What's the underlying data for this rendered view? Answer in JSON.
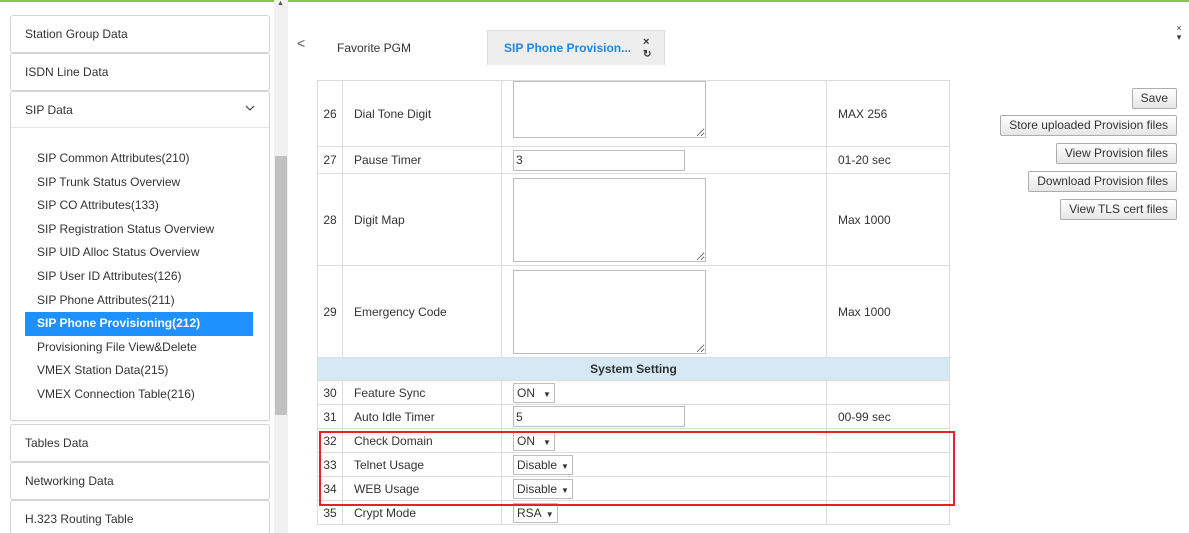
{
  "sidebar": {
    "groups": {
      "station_group": "Station Group Data",
      "isdn_line": "ISDN Line Data",
      "sip_data": "SIP Data",
      "tables": "Tables Data",
      "networking": "Networking Data",
      "h323": "H.323 Routing Table"
    },
    "sip_items": [
      "SIP Common Attributes(210)",
      "SIP Trunk Status Overview",
      "SIP CO Attributes(133)",
      "SIP Registration Status Overview",
      "SIP UID Alloc Status Overview",
      "SIP User ID Attributes(126)",
      "SIP Phone Attributes(211)",
      "SIP Phone Provisioning(212)",
      "Provisioning File View&Delete",
      "VMEX Station Data(215)",
      "VMEX Connection Table(216)"
    ],
    "active_index": 7
  },
  "tabs": {
    "nav_prev": "<",
    "favorite": "Favorite PGM",
    "active": "SIP Phone Provision...",
    "close_glyph": "×",
    "refresh_glyph": "↻"
  },
  "window": {
    "close_glyph": "×",
    "menu_glyph": "▾"
  },
  "rows": {
    "r26": {
      "num": "26",
      "name": "Dial Tone Digit",
      "value": "",
      "note": "MAX 256"
    },
    "r27": {
      "num": "27",
      "name": "Pause Timer",
      "value": "3",
      "note": "01-20 sec"
    },
    "r28": {
      "num": "28",
      "name": "Digit Map",
      "value": "",
      "note": "Max 1000"
    },
    "r29": {
      "num": "29",
      "name": "Emergency Code",
      "value": "",
      "note": "Max 1000"
    },
    "section": "System Setting",
    "r30": {
      "num": "30",
      "name": "Feature Sync",
      "value": "ON",
      "note": ""
    },
    "r31": {
      "num": "31",
      "name": "Auto Idle Timer",
      "value": "5",
      "note": "00-99 sec"
    },
    "r32": {
      "num": "32",
      "name": "Check Domain",
      "value": "ON",
      "note": ""
    },
    "r33": {
      "num": "33",
      "name": "Telnet Usage",
      "value": "Disable",
      "note": ""
    },
    "r34": {
      "num": "34",
      "name": "WEB Usage",
      "value": "Disable",
      "note": ""
    },
    "r35": {
      "num": "35",
      "name": "Crypt Mode",
      "value": "RSA",
      "note": ""
    }
  },
  "actions": {
    "save": "Save",
    "store": "Store uploaded Provision files",
    "view": "View Provision files",
    "download": "Download Provision files",
    "tls": "View TLS cert files"
  },
  "colors": {
    "accent": "#1e90ff",
    "section_bg": "#d5e9f5",
    "highlight": "#e8202a",
    "top_line": "#8dc63f"
  }
}
